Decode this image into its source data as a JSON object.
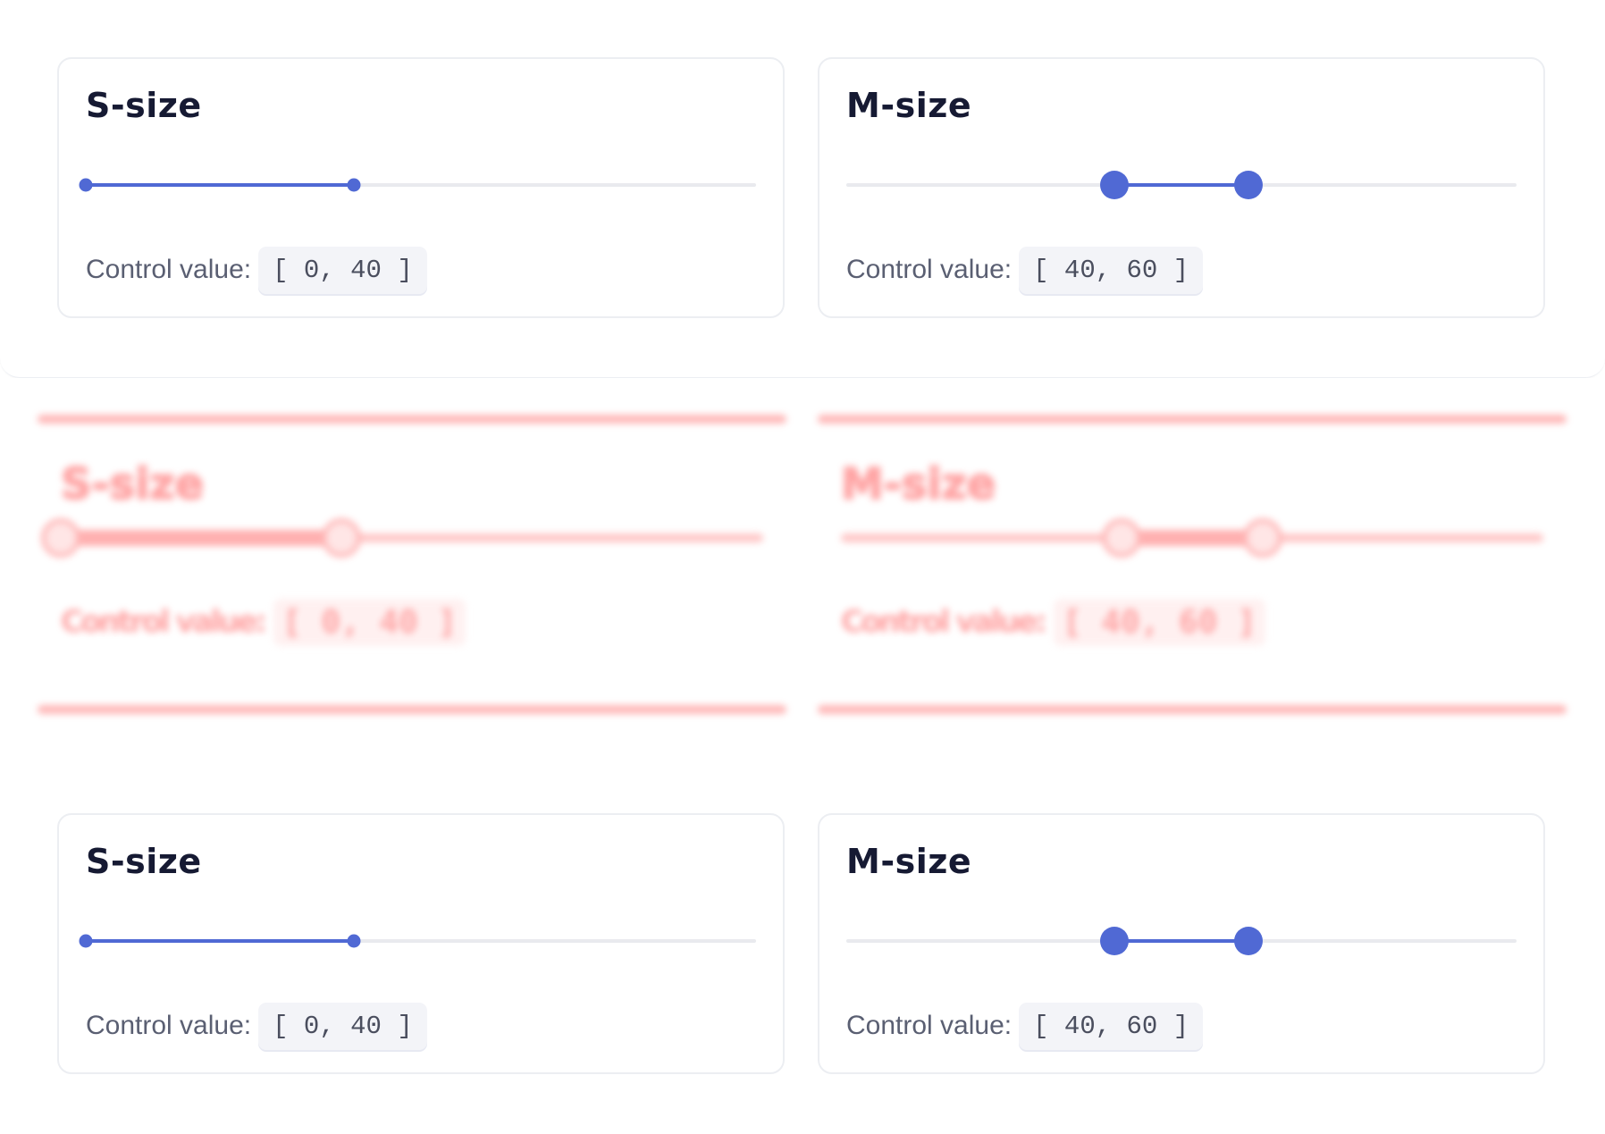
{
  "sections": {
    "top": {
      "cards": [
        {
          "title": "S-size",
          "size": "s",
          "range": [
            0,
            100
          ],
          "value": [
            0,
            40
          ],
          "control_label": "Control value:",
          "control_value": "[ 0, 40 ]"
        },
        {
          "title": "M-size",
          "size": "m",
          "range": [
            0,
            100
          ],
          "value": [
            40,
            60
          ],
          "control_label": "Control value:",
          "control_value": "[ 40, 60 ]"
        }
      ]
    },
    "diff": {
      "cards": [
        {
          "title": "S-size",
          "value": [
            0,
            40
          ],
          "control_label": "Control value:",
          "control_value": "[ 0, 40 ]"
        },
        {
          "title": "M-size",
          "value": [
            40,
            60
          ],
          "control_label": "Control value:",
          "control_value": "[ 40, 60 ]"
        }
      ]
    },
    "bottom": {
      "cards": [
        {
          "title": "S-size",
          "size": "s",
          "range": [
            0,
            100
          ],
          "value": [
            0,
            40
          ],
          "control_label": "Control value:",
          "control_value": "[ 0, 40 ]"
        },
        {
          "title": "M-size",
          "size": "m",
          "range": [
            0,
            100
          ],
          "value": [
            40,
            60
          ],
          "control_label": "Control value:",
          "control_value": "[ 40, 60 ]"
        }
      ]
    }
  },
  "colors": {
    "accent": "#5069d4",
    "track": "#e9eaee",
    "title": "#161a33",
    "label": "#5a5f72",
    "diff": "#ff5c5c"
  }
}
